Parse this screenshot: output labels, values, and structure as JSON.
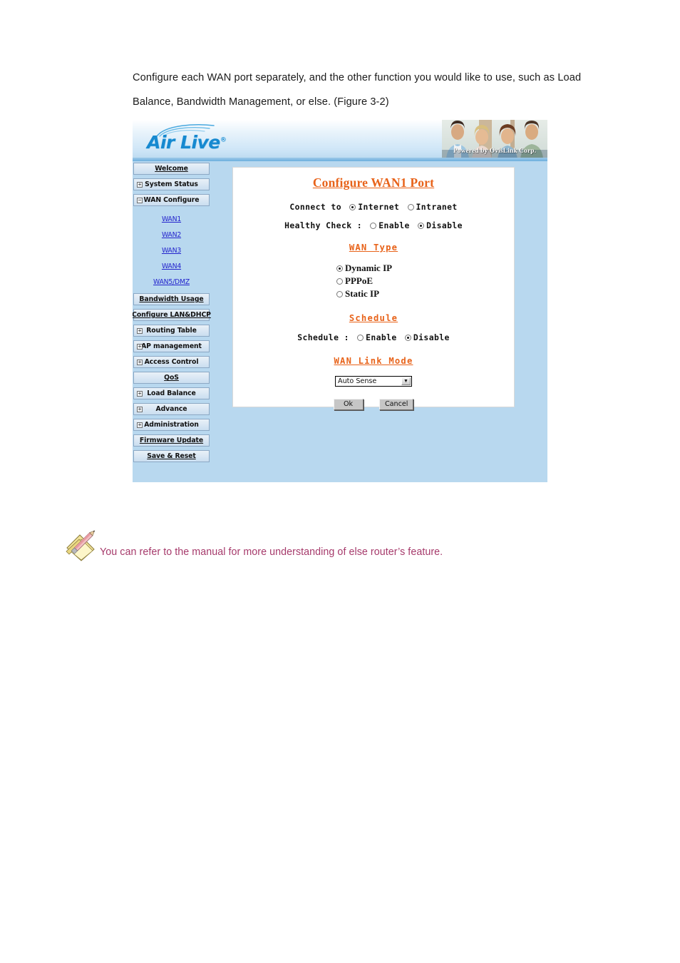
{
  "document": {
    "paragraph": "Configure each WAN port separately, and the other function you would like to use, such as Load Balance, Bandwidth Management, or else. (Figure 3-2)"
  },
  "router_ui": {
    "header": {
      "logo_text": "Air Live",
      "logo_registered": "®",
      "banner_caption": "Powered by OvisLink Corp."
    },
    "sidebar": {
      "items": [
        {
          "label": "Welcome",
          "toggle": null
        },
        {
          "label": "System Status",
          "toggle": "+"
        },
        {
          "label": "WAN Configure",
          "toggle": "−"
        },
        {
          "label": "Bandwidth Usage",
          "toggle": null
        },
        {
          "label": "Configure LAN&DHCP",
          "toggle": null
        },
        {
          "label": "Routing Table",
          "toggle": "+"
        },
        {
          "label": "AP management",
          "toggle": "+"
        },
        {
          "label": "Access Control",
          "toggle": "+"
        },
        {
          "label": "QoS",
          "toggle": null
        },
        {
          "label": "Load Balance",
          "toggle": "+"
        },
        {
          "label": "Advance",
          "toggle": "+"
        },
        {
          "label": "Administration",
          "toggle": "+"
        },
        {
          "label": "Firmware Update",
          "toggle": null
        },
        {
          "label": "Save & Reset",
          "toggle": null
        }
      ],
      "wan_submenu": [
        {
          "label": "WAN1"
        },
        {
          "label": "WAN2"
        },
        {
          "label": "WAN3"
        },
        {
          "label": "WAN4"
        },
        {
          "label": "WAN5/DMZ"
        }
      ]
    },
    "panel": {
      "title": "Configure WAN1 Port",
      "connect_to": {
        "label": "Connect to",
        "options": [
          {
            "label": "Internet",
            "selected": true
          },
          {
            "label": "Intranet",
            "selected": false
          }
        ]
      },
      "healthy_check": {
        "label": "Healthy Check :",
        "options": [
          {
            "label": "Enable",
            "selected": false
          },
          {
            "label": "Disable",
            "selected": true
          }
        ]
      },
      "wan_type": {
        "heading": "WAN Type",
        "options": [
          {
            "label": "Dynamic IP",
            "selected": true
          },
          {
            "label": "PPPoE",
            "selected": false
          },
          {
            "label": "Static IP",
            "selected": false
          }
        ]
      },
      "schedule": {
        "heading": "Schedule",
        "label": "Schedule :",
        "options": [
          {
            "label": "Enable",
            "selected": false
          },
          {
            "label": "Disable",
            "selected": true
          }
        ]
      },
      "wan_link_mode": {
        "heading": "WAN Link Mode",
        "selected_value": "Auto Sense"
      },
      "buttons": {
        "ok": "Ok",
        "cancel": "Cancel"
      }
    },
    "colors": {
      "background": "#b8d8ef",
      "accent_orange": "#e8631a",
      "logo_blue": "#1689d0",
      "link_blue": "#2222cc"
    }
  },
  "note": {
    "text": "You can refer to the manual for more understanding of else router’s feature.",
    "icon": "note-pencil-icon",
    "color": "#a63a6b"
  }
}
